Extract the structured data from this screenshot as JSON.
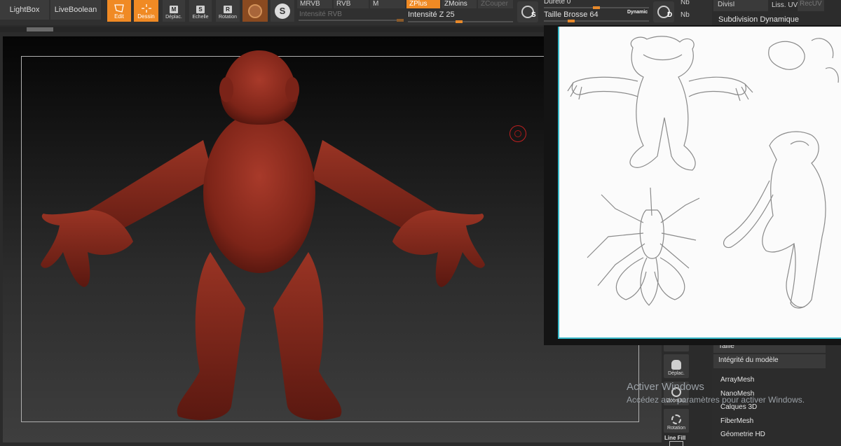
{
  "toolbar": {
    "lightbox": "LightBox",
    "liveboolean": "LiveBoolean",
    "edit": "Edit",
    "dessin": "Dessin",
    "deplac": "Déplac.",
    "echelle": "Echelle",
    "rotation": "Rotation",
    "modes": {
      "mrvb": "MRVB",
      "rvb": "RVB",
      "m": "M",
      "zplus": "ZPlus",
      "zmoins": "ZMoins",
      "zcouper": "ZCouper"
    },
    "intensite_rvb": "Intensité RVB",
    "intensite_z": "Intensité Z 25",
    "durete": "Dureté 0",
    "taille_brosse": "Taille Brosse 64",
    "dynamic": "Dynamic",
    "nb1": "Nb",
    "nb2": "Nb",
    "btn_s": "S",
    "btn_d": "D"
  },
  "right_panel": {
    "divisions": "DivisI",
    "liss_uv": "Liss. UV",
    "rec_uv": "RecUV",
    "subdivision": "Subdivision Dynamique",
    "taille": "Taille",
    "integrite": "Intégrité du modèle",
    "items": [
      "ArrayMesh",
      "NanoMesh",
      "Calques 3D",
      "FiberMesh",
      "Géometrie HD"
    ]
  },
  "shelf": {
    "deplac": "Déplac.",
    "zoom3d": "Zoom3D",
    "rotation": "Rotation",
    "linefill": "Line Fill"
  },
  "watermark": {
    "title": "Activer Windows",
    "subtitle": "Accédez aux paramètres pour activer Windows."
  },
  "colors": {
    "accent": "#f08a24",
    "model": "#8a2a20",
    "frame_cyan": "#37b8c8"
  }
}
